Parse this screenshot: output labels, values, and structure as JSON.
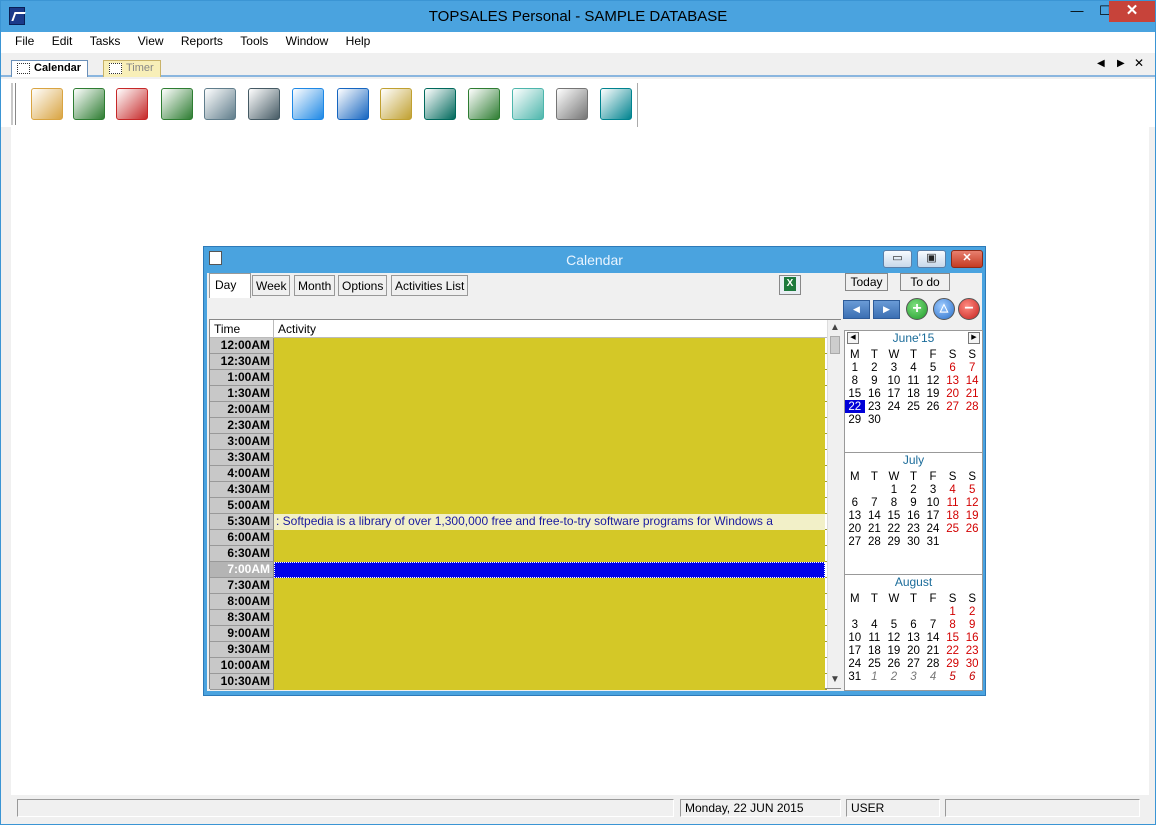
{
  "window": {
    "title": "TOPSALES Personal - SAMPLE DATABASE",
    "min_glyph": "—",
    "max_glyph": "☐",
    "close_glyph": "✕"
  },
  "menu": [
    "File",
    "Edit",
    "Tasks",
    "View",
    "Reports",
    "Tools",
    "Window",
    "Help"
  ],
  "doc_tabs": {
    "calendar": "Calendar",
    "timer": "Timer",
    "prev_glyph": "◀",
    "next_glyph": "▶",
    "close_glyph": "✕"
  },
  "toolbar_icons": [
    {
      "name": "contacts-folder-icon",
      "color": "#d9a441"
    },
    {
      "name": "people-icon",
      "color": "#2e7d32"
    },
    {
      "name": "letter-writing-icon",
      "color": "#c62828"
    },
    {
      "name": "address-card-icon",
      "color": "#2e7d32"
    },
    {
      "name": "calendar-97-icon",
      "color": "#607d8b"
    },
    {
      "name": "contact-eye-icon",
      "color": "#455a64"
    },
    {
      "name": "globe-computer-icon",
      "color": "#1e88e5"
    },
    {
      "name": "dollar-document-icon",
      "color": "#1565c0"
    },
    {
      "name": "cash-register-icon",
      "color": "#c0a030"
    },
    {
      "name": "bank-icon",
      "color": "#00695c"
    },
    {
      "name": "warehouse-icon",
      "color": "#2e7d32"
    },
    {
      "name": "desk-lamp-icon",
      "color": "#4db6ac"
    },
    {
      "name": "stopwatch-icon",
      "color": "#757575"
    },
    {
      "name": "calculator-icon",
      "color": "#00838f"
    }
  ],
  "calendar_window": {
    "title": "Calendar",
    "min_glyph": "▭",
    "max_glyph": "▣",
    "close_glyph": "✕",
    "tabs": {
      "day": "Day",
      "week": "Week",
      "month": "Month",
      "options": "Options",
      "list": "Activities List"
    },
    "buttons": {
      "today": "Today",
      "todo": "To do",
      "prev_glyph": "◀",
      "next_glyph": "▶",
      "add_glyph": "+",
      "edit_glyph": "△",
      "delete_glyph": "−"
    },
    "grid": {
      "time_header": "Time",
      "activity_header": "Activity",
      "scroll_up_glyph": "▲",
      "scroll_down_glyph": "▼",
      "rows": [
        {
          "time": "12:00AM",
          "activity": ""
        },
        {
          "time": "12:30AM",
          "activity": ""
        },
        {
          "time": "1:00AM",
          "activity": ""
        },
        {
          "time": "1:30AM",
          "activity": ""
        },
        {
          "time": "2:00AM",
          "activity": ""
        },
        {
          "time": "2:30AM",
          "activity": ""
        },
        {
          "time": "3:00AM",
          "activity": ""
        },
        {
          "time": "3:30AM",
          "activity": ""
        },
        {
          "time": "4:00AM",
          "activity": ""
        },
        {
          "time": "4:30AM",
          "activity": ""
        },
        {
          "time": "5:00AM",
          "activity": ""
        },
        {
          "time": "5:30AM",
          "activity": ": Softpedia is a library of over 1,300,000 free and free-to-try software programs for Windows a",
          "note": true
        },
        {
          "time": "6:00AM",
          "activity": ""
        },
        {
          "time": "6:30AM",
          "activity": ""
        },
        {
          "time": "7:00AM",
          "activity": "",
          "selected": true
        },
        {
          "time": "7:30AM",
          "activity": ""
        },
        {
          "time": "8:00AM",
          "activity": ""
        },
        {
          "time": "8:30AM",
          "activity": ""
        },
        {
          "time": "9:00AM",
          "activity": ""
        },
        {
          "time": "9:30AM",
          "activity": ""
        },
        {
          "time": "10:00AM",
          "activity": ""
        },
        {
          "time": "10:30AM",
          "activity": ""
        }
      ]
    },
    "weekdays": [
      "M",
      "T",
      "W",
      "T",
      "F",
      "S",
      "S"
    ],
    "months": [
      {
        "id": "june",
        "title": "June'15",
        "arrows": true,
        "prev_glyph": "◀",
        "next_glyph": "▶",
        "weeks": [
          [
            1,
            2,
            3,
            4,
            5,
            6,
            7
          ],
          [
            8,
            9,
            10,
            11,
            12,
            13,
            14
          ],
          [
            15,
            16,
            17,
            18,
            19,
            20,
            21
          ],
          [
            22,
            23,
            24,
            25,
            26,
            27,
            28
          ],
          [
            29,
            30,
            null,
            null,
            null,
            null,
            null
          ]
        ],
        "today": 22
      },
      {
        "id": "july",
        "title": "July",
        "arrows": false,
        "weeks": [
          [
            null,
            null,
            1,
            2,
            3,
            4,
            5
          ],
          [
            6,
            7,
            8,
            9,
            10,
            11,
            12
          ],
          [
            13,
            14,
            15,
            16,
            17,
            18,
            19
          ],
          [
            20,
            21,
            22,
            23,
            24,
            25,
            26
          ],
          [
            27,
            28,
            29,
            30,
            31,
            null,
            null
          ]
        ]
      },
      {
        "id": "aug",
        "title": "August",
        "arrows": false,
        "weeks": [
          [
            null,
            null,
            null,
            null,
            null,
            1,
            2
          ],
          [
            3,
            4,
            5,
            6,
            7,
            8,
            9
          ],
          [
            10,
            11,
            12,
            13,
            14,
            15,
            16
          ],
          [
            17,
            18,
            19,
            20,
            21,
            22,
            23
          ],
          [
            24,
            25,
            26,
            27,
            28,
            29,
            30
          ],
          [
            31,
            "1o",
            "2o",
            "3o",
            "4o",
            "5o",
            "6o"
          ]
        ]
      }
    ]
  },
  "status": {
    "pane1": "",
    "date": "Monday, 22 JUN 2015",
    "user": "USER",
    "pane4": ""
  }
}
